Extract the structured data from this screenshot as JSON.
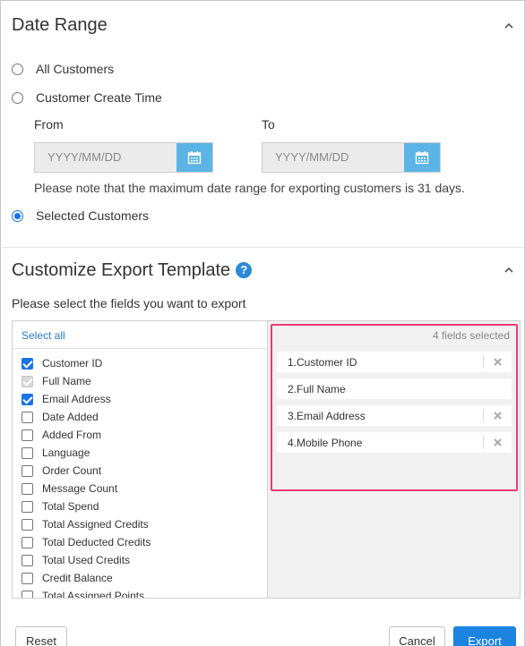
{
  "date_range": {
    "title": "Date Range",
    "options": {
      "all_customers": "All Customers",
      "customer_create_time": "Customer Create Time",
      "selected_customers": "Selected Customers"
    },
    "from_label": "From",
    "to_label": "To",
    "from_placeholder": "YYYY/MM/DD",
    "to_placeholder": "YYYY/MM/DD",
    "note": "Please note that the maximum date range for exporting customers is 31 days.",
    "selected_option": "selected_customers"
  },
  "template": {
    "title": "Customize Export Template",
    "help_icon": "question-circle-icon",
    "instruction": "Please select the fields you want to export",
    "select_all": "Select all",
    "fields": [
      {
        "label": "Customer ID",
        "state": "checked"
      },
      {
        "label": "Full Name",
        "state": "checked-disabled"
      },
      {
        "label": "Email Address",
        "state": "checked"
      },
      {
        "label": "Date Added",
        "state": "unchecked"
      },
      {
        "label": "Added From",
        "state": "unchecked"
      },
      {
        "label": "Language",
        "state": "unchecked"
      },
      {
        "label": "Order Count",
        "state": "unchecked"
      },
      {
        "label": "Message Count",
        "state": "unchecked"
      },
      {
        "label": "Total Spend",
        "state": "unchecked"
      },
      {
        "label": "Total Assigned Credits",
        "state": "unchecked"
      },
      {
        "label": "Total Deducted Credits",
        "state": "unchecked"
      },
      {
        "label": "Total Used Credits",
        "state": "unchecked"
      },
      {
        "label": "Credit Balance",
        "state": "unchecked"
      },
      {
        "label": "Total Assigned Points",
        "state": "unchecked"
      }
    ],
    "selected_count": "4 fields selected",
    "selected_fields": [
      {
        "label": "1.Customer ID",
        "removable": true
      },
      {
        "label": "2.Full Name",
        "removable": false
      },
      {
        "label": "3.Email Address",
        "removable": true
      },
      {
        "label": "4.Mobile Phone",
        "removable": true
      }
    ]
  },
  "footer": {
    "reset": "Reset",
    "cancel": "Cancel",
    "export": "Export"
  },
  "colors": {
    "accent": "#1a73e8",
    "calendar_button": "#5bb4e5",
    "highlight_border": "#e83a76",
    "link": "#2a7ac8"
  }
}
